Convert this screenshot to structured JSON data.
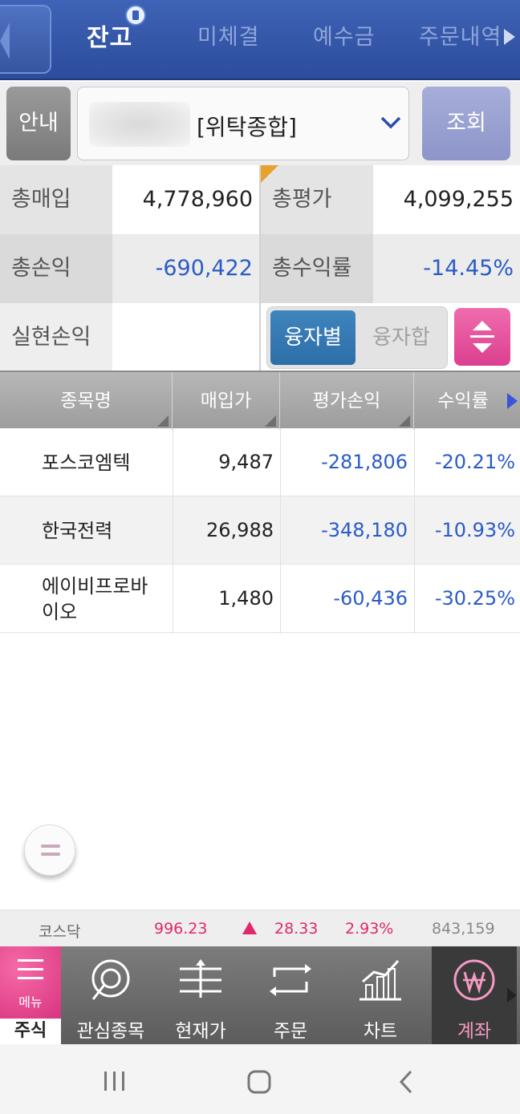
{
  "tabs": [
    {
      "label": "잔고",
      "active": true
    },
    {
      "label": "미체결",
      "active": false
    },
    {
      "label": "예수금",
      "active": false
    },
    {
      "label": "주문내역",
      "active": false
    }
  ],
  "account": {
    "info_label": "안내",
    "type": "[위탁종합]",
    "query_label": "조회"
  },
  "summary": {
    "total_purchase_label": "총매입",
    "total_purchase": "4,778,960",
    "total_eval_label": "총평가",
    "total_eval": "4,099,255",
    "total_pl_label": "총손익",
    "total_pl": "-690,422",
    "total_rate_label": "총수익률",
    "total_rate": "-14.45%",
    "realized_label": "실현손익",
    "realized": "",
    "toggle_on": "융자별",
    "toggle_off": "융자합"
  },
  "table": {
    "headers": [
      "종목명",
      "매입가",
      "평가손익",
      "수익률"
    ],
    "rows": [
      {
        "name": "포스코엠텍",
        "price": "9,487",
        "pl": "-281,806",
        "rate": "-20.21%"
      },
      {
        "name": "한국전력",
        "price": "26,988",
        "pl": "-348,180",
        "rate": "-10.93%"
      },
      {
        "name": "에이비프로바이오",
        "price": "1,480",
        "pl": "-60,436",
        "rate": "-30.25%"
      }
    ]
  },
  "ticker": {
    "index": "코스닥",
    "value": "996.23",
    "change": "28.33",
    "rate": "2.93%",
    "volume": "843,159"
  },
  "bottom_nav": {
    "menu_label": "메뉴",
    "stock_label": "주식",
    "items": [
      {
        "label": "관심종목",
        "icon": "favorites-icon"
      },
      {
        "label": "현재가",
        "icon": "current-price-icon"
      },
      {
        "label": "주문",
        "icon": "order-icon"
      },
      {
        "label": "차트",
        "icon": "chart-icon"
      },
      {
        "label": "계좌",
        "icon": "won-account-icon",
        "active": true
      }
    ]
  },
  "colors": {
    "accent_blue": "#2c4c9c",
    "negative": "#2a5bc7",
    "positive": "#e0286d",
    "pink": "#db3f8f"
  }
}
